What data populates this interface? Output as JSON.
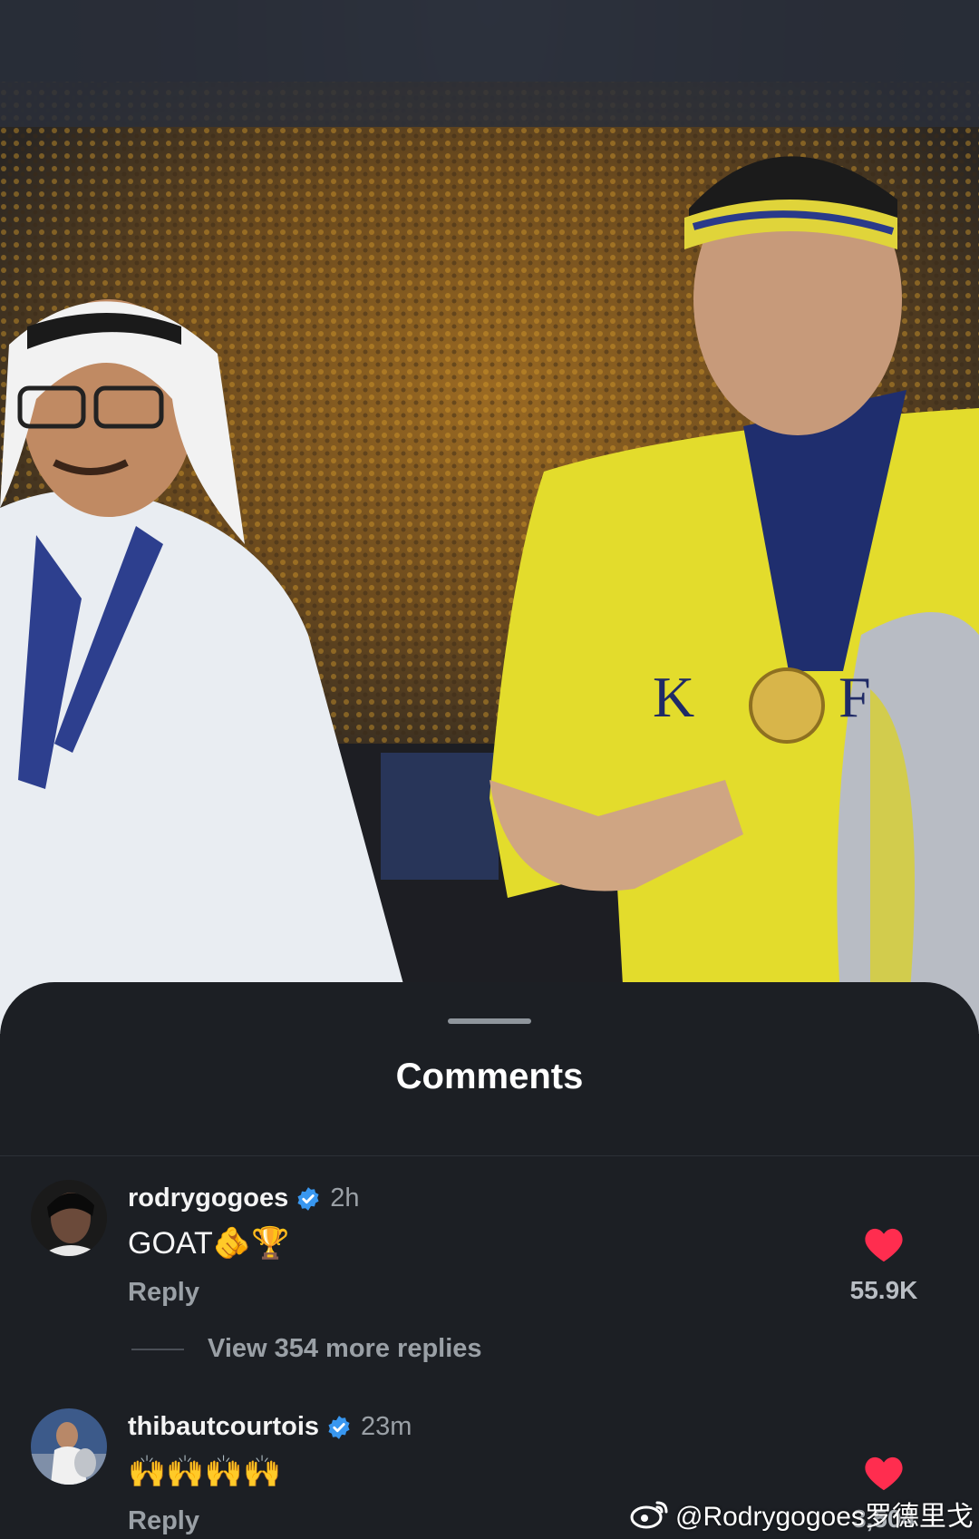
{
  "sheet": {
    "title": "Comments"
  },
  "comments": [
    {
      "username": "rodrygogoes",
      "verified": true,
      "time": "2h",
      "text": "GOAT🫵🏆",
      "reply_label": "Reply",
      "likes": "55.9K",
      "liked": true,
      "view_more": "View 354 more replies"
    },
    {
      "username": "thibautcourtois",
      "verified": true,
      "time": "23m",
      "text": "🙌🙌🙌🙌",
      "reply_label": "Reply",
      "likes": "3,504",
      "liked": true
    }
  ],
  "watermark": {
    "text": "@Rodrygogoes罗德里戈",
    "icon": "weibo-icon"
  },
  "colors": {
    "sheet_bg": "#1c1f24",
    "heart": "#ff2d4f",
    "verified": "#3897f0",
    "jersey": "#e6df2a"
  }
}
